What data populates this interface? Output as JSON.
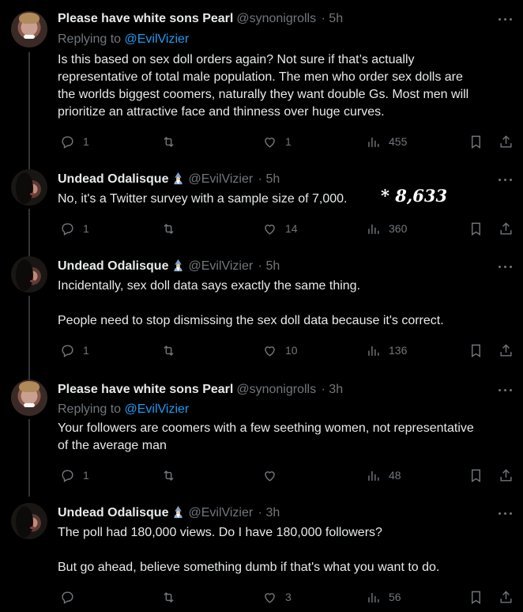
{
  "tweets": [
    {
      "name": "Please have white sons Pearl",
      "handle": "@synonigrolls",
      "time": "· 5h",
      "replying_prefix": "Replying to",
      "replying_to": "@EvilVizier",
      "lines": [
        "Is this based on sex doll orders again? Not sure if that’s actually",
        "representative of total male population. The men who order sex dolls are",
        "the worlds biggest coomers, naturally they want double Gs. Most men will",
        "prioritize an attractive face and thinness over huge curves."
      ],
      "stats": {
        "replies": "1",
        "reposts": "",
        "likes": "1",
        "views": "455"
      }
    },
    {
      "name": "Undead Odalisque",
      "handle": "@EvilVizier",
      "time": "· 5h",
      "lines": [
        "No, it's a Twitter survey with a sample size of 7,000."
      ],
      "annotation": "* 8,633",
      "stats": {
        "replies": "1",
        "reposts": "",
        "likes": "14",
        "views": "360"
      }
    },
    {
      "name": "Undead Odalisque",
      "handle": "@EvilVizier",
      "time": "· 5h",
      "lines": [
        "Incidentally, sex doll data says exactly the same thing.",
        "People need to stop dismissing the sex doll data because it's correct."
      ],
      "stats": {
        "replies": "1",
        "reposts": "",
        "likes": "10",
        "views": "136"
      }
    },
    {
      "name": "Please have white sons Pearl",
      "handle": "@synonigrolls",
      "time": "· 3h",
      "replying_prefix": "Replying to",
      "replying_to": "@EvilVizier",
      "lines": [
        "Your followers are coomers with a few seething women, not representative",
        "of the average man"
      ],
      "stats": {
        "replies": "1",
        "reposts": "",
        "likes": "",
        "views": "48"
      }
    },
    {
      "name": "Undead Odalisque",
      "handle": "@EvilVizier",
      "time": "· 3h",
      "lines": [
        "The poll had 180,000 views. Do I have 180,000 followers?",
        "But go ahead, believe something dumb if that's what you want to do."
      ],
      "stats": {
        "replies": "",
        "reposts": "",
        "likes": "3",
        "views": "56"
      }
    }
  ],
  "icons": {
    "more": "more-dots-icon",
    "reply": "reply-bubble-icon",
    "repost": "repost-arrows-icon",
    "like": "heart-icon",
    "views": "views-bar-chart-icon",
    "bookmark": "bookmark-icon",
    "share": "share-upload-icon",
    "badge": "mage-emoji-icon"
  },
  "colors": {
    "background": "#000000",
    "text": "#e7e9ea",
    "muted": "#71767b",
    "link": "#1d9bf0",
    "divider": "#333639"
  }
}
